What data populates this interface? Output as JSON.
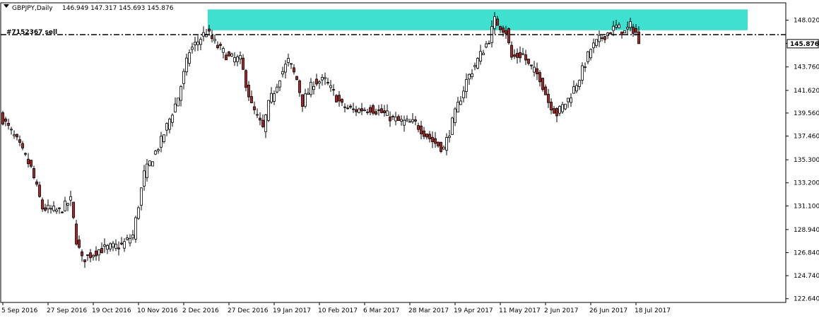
{
  "header": {
    "symbol_timeframe": "GBPJPY,Daily",
    "ohlc": "146.949 147.317 145.693 145.876"
  },
  "trade_label": "#7152367 sell",
  "current_price_label": "145.876",
  "colors": {
    "bull_fill": "#ffffff",
    "bear_fill": "#b22222",
    "candle_outline": "#000000",
    "zone_fill": "#40e0d0",
    "price_box_fill": "#ffffff",
    "background": "#ffffff"
  },
  "chart_data": {
    "type": "candlestick",
    "y_ticks": [
      "148.020",
      "145.900",
      "143.760",
      "141.620",
      "139.560",
      "137.460",
      "135.300",
      "133.200",
      "131.100",
      "128.940",
      "126.840",
      "124.740",
      "122.640"
    ],
    "y_tick_values": [
      148.02,
      145.9,
      143.76,
      141.62,
      139.56,
      137.46,
      135.3,
      133.2,
      131.1,
      128.94,
      126.84,
      124.74,
      122.64
    ],
    "x_tick_labels": [
      "5 Sep 2016",
      "27 Sep 2016",
      "19 Oct 2016",
      "10 Nov 2016",
      "2 Dec 2016",
      "27 Dec 2016",
      "19 Jan 2017",
      "10 Feb 2017",
      "6 Mar 2017",
      "28 Mar 2017",
      "19 Apr 2017",
      "11 May 2017",
      "2 Jun 2017",
      "26 Jun 2017",
      "18 Jul 2017"
    ],
    "x_tick_bar_index": [
      0,
      16,
      32,
      48,
      64,
      80,
      96,
      112,
      128,
      144,
      160,
      176,
      192,
      208,
      224
    ],
    "ylim": [
      122.3,
      149.6
    ],
    "bar_count": 226,
    "resistance_zone": {
      "from": 147.1,
      "to": 149.0,
      "start_bar": 73,
      "end_bar": 264
    },
    "sell_level": 146.7,
    "current_price": 145.876,
    "anchors": [
      [
        0,
        139.0
      ],
      [
        5,
        137.0
      ],
      [
        10,
        134.5
      ],
      [
        14,
        130.9
      ],
      [
        20,
        130.6
      ],
      [
        24,
        131.6
      ],
      [
        26,
        128.0
      ],
      [
        28,
        126.2
      ],
      [
        34,
        127.1
      ],
      [
        42,
        127.5
      ],
      [
        46,
        128.4
      ],
      [
        50,
        134.0
      ],
      [
        56,
        137.0
      ],
      [
        62,
        141.0
      ],
      [
        66,
        145.2
      ],
      [
        72,
        147.0
      ],
      [
        76,
        145.6
      ],
      [
        80,
        144.6
      ],
      [
        84,
        144.4
      ],
      [
        88,
        140.2
      ],
      [
        92,
        138.1
      ],
      [
        94,
        140.3
      ],
      [
        98,
        142.9
      ],
      [
        101,
        144.3
      ],
      [
        104,
        142.6
      ],
      [
        106,
        140.5
      ],
      [
        110,
        142.4
      ],
      [
        114,
        142.5
      ],
      [
        120,
        140.2
      ],
      [
        124,
        139.8
      ],
      [
        130,
        140.0
      ],
      [
        134,
        139.6
      ],
      [
        140,
        138.8
      ],
      [
        146,
        138.6
      ],
      [
        152,
        137.0
      ],
      [
        156,
        136.3
      ],
      [
        160,
        139.5
      ],
      [
        164,
        142.5
      ],
      [
        168,
        144.4
      ],
      [
        172,
        146.3
      ],
      [
        174,
        148.0
      ],
      [
        178,
        147.0
      ],
      [
        180,
        144.6
      ],
      [
        184,
        144.9
      ],
      [
        186,
        143.9
      ],
      [
        190,
        142.8
      ],
      [
        193,
        140.6
      ],
      [
        196,
        139.5
      ],
      [
        200,
        140.8
      ],
      [
        204,
        142.8
      ],
      [
        208,
        145.4
      ],
      [
        212,
        146.5
      ],
      [
        217,
        147.4
      ],
      [
        220,
        146.9
      ],
      [
        222,
        147.5
      ],
      [
        224,
        146.9
      ],
      [
        225,
        145.9
      ]
    ]
  }
}
